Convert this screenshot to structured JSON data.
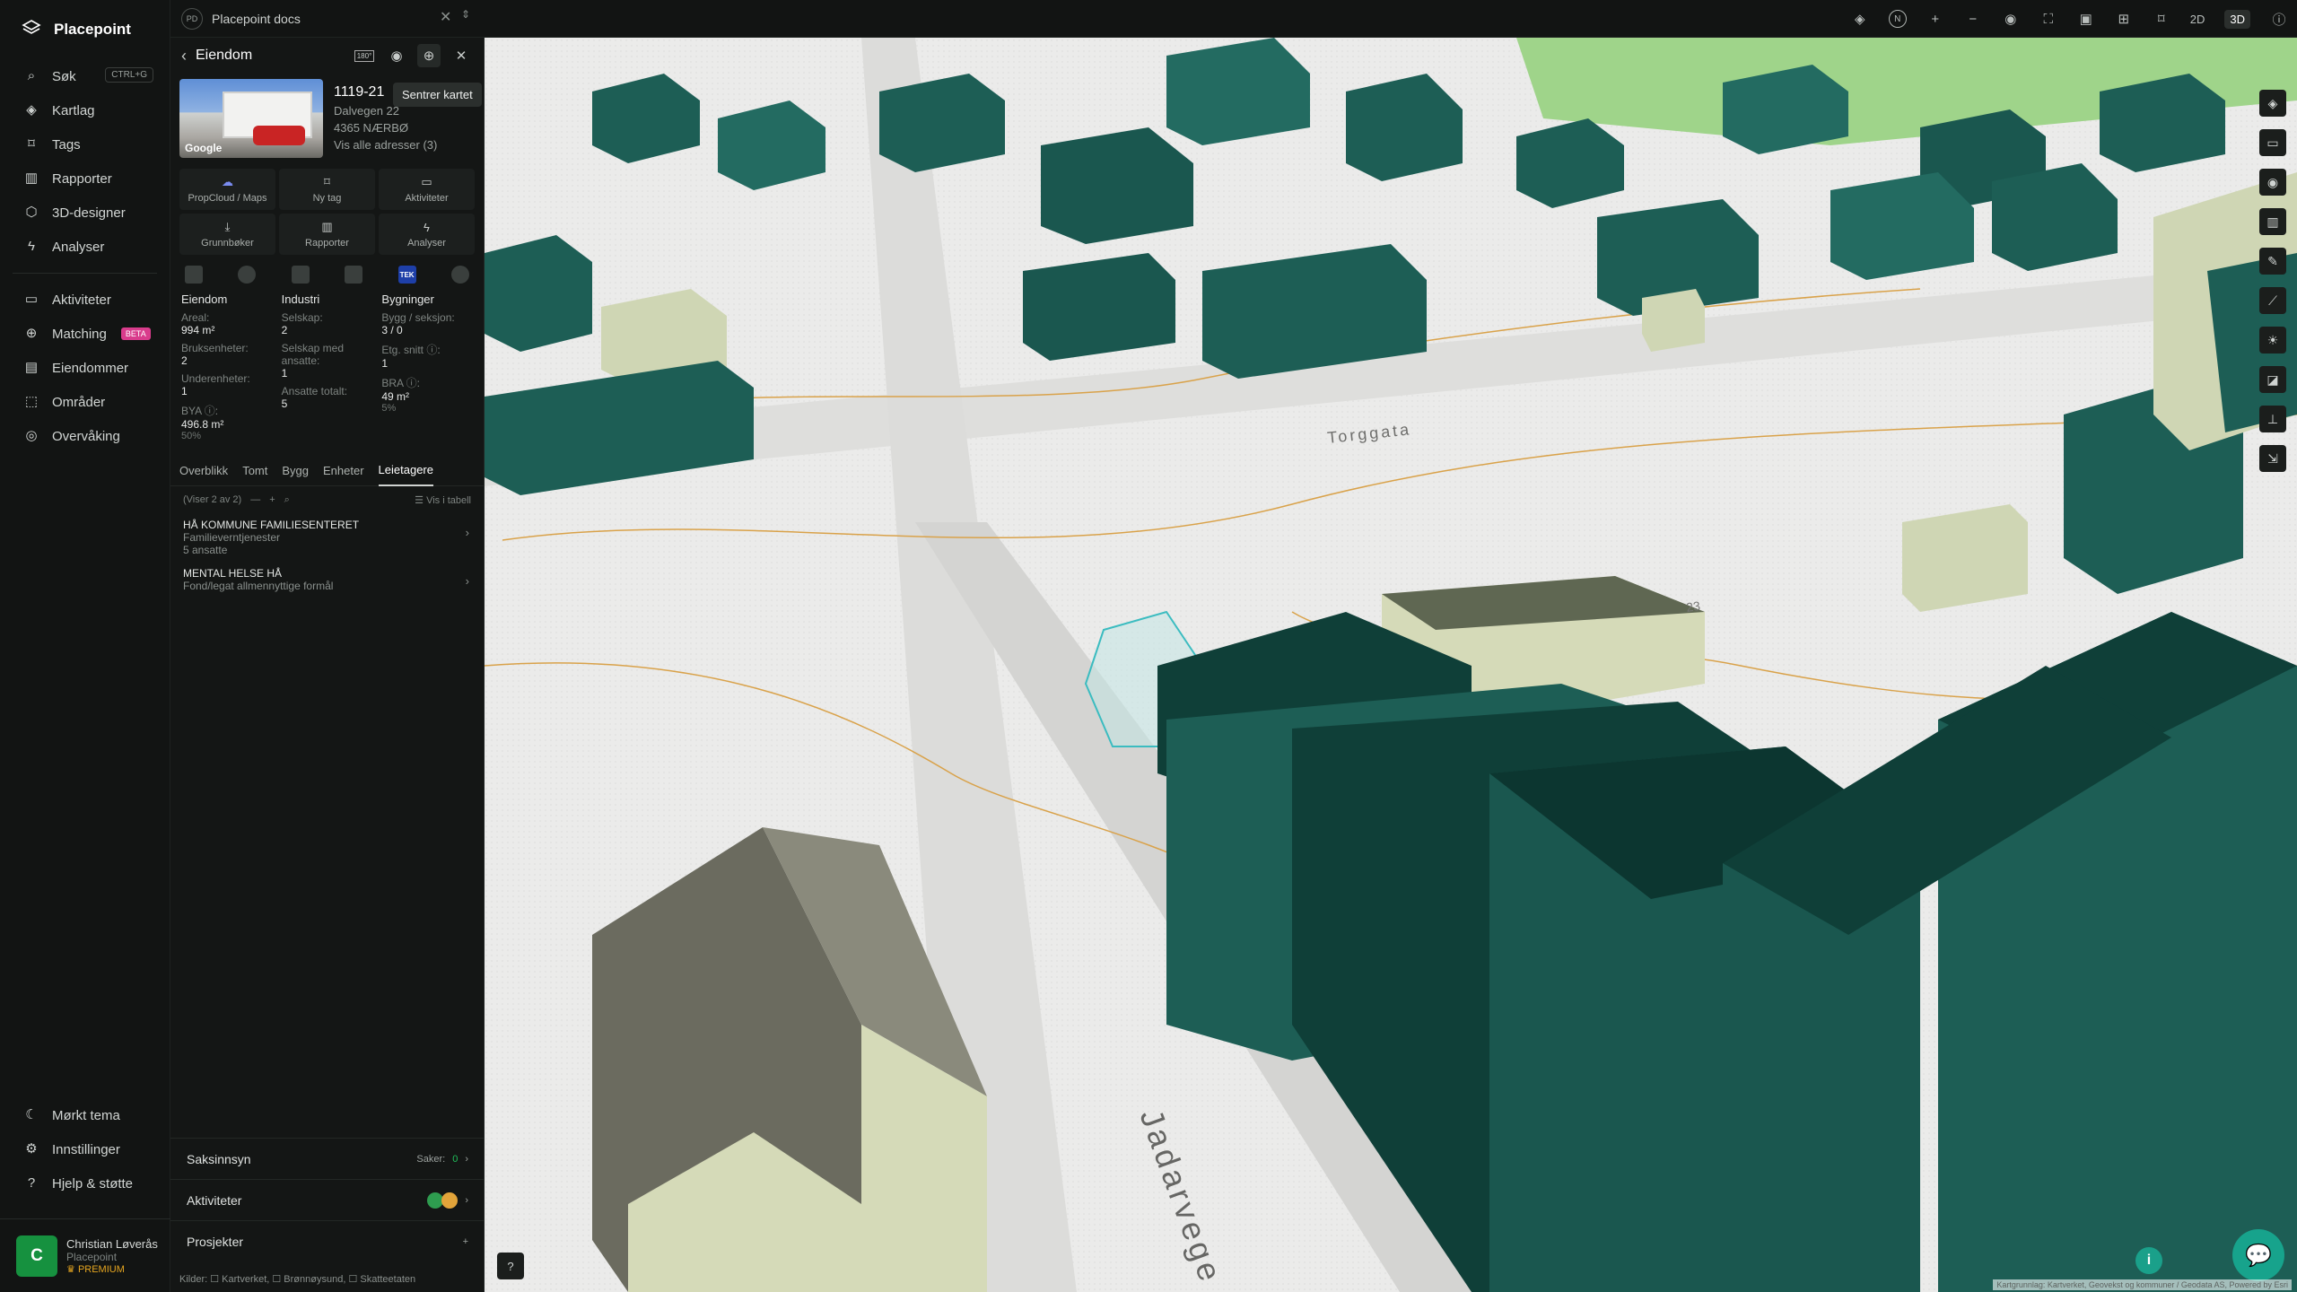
{
  "app": {
    "name": "Placepoint"
  },
  "nav": {
    "items": [
      {
        "label": "Søk",
        "kbd": "CTRL+G"
      },
      {
        "label": "Kartlag"
      },
      {
        "label": "Tags"
      },
      {
        "label": "Rapporter"
      },
      {
        "label": "3D-designer"
      },
      {
        "label": "Analyser"
      }
    ],
    "items2": [
      {
        "label": "Aktiviteter"
      },
      {
        "label": "Matching",
        "badge": "BETA"
      },
      {
        "label": "Eiendommer"
      },
      {
        "label": "Områder"
      },
      {
        "label": "Overvåking"
      }
    ],
    "bottom": [
      {
        "label": "Mørkt tema"
      },
      {
        "label": "Innstillinger"
      },
      {
        "label": "Hjelp & støtte"
      }
    ],
    "user": {
      "initial": "C",
      "name": "Christian Løverås",
      "org": "Placepoint",
      "plan": "PREMIUM"
    }
  },
  "topbar": {
    "doc_initials": "PD",
    "doc_title": "Placepoint docs",
    "north": "N",
    "mode_2d": "2D",
    "mode_3d": "3D"
  },
  "panel": {
    "title": "Eiendom",
    "tooltip": "Sentrer kartet",
    "badge": "180°",
    "photo_label": "Google",
    "gnr": "1119-21",
    "address": "Dalvegen 22",
    "postal": "4365 NÆRBØ",
    "all_addresses": "Vis alle adresser (3)",
    "actions": [
      {
        "label": "PropCloud / Maps"
      },
      {
        "label": "Ny tag"
      },
      {
        "label": "Aktiviteter"
      },
      {
        "label": "Grunnbøker"
      },
      {
        "label": "Rapporter"
      },
      {
        "label": "Analyser"
      }
    ],
    "tek_label": "TEK",
    "stats": {
      "col1_head": "Eiendom",
      "col2_head": "Industri",
      "col3_head": "Bygninger",
      "areal_k": "Areal:",
      "areal_v": "994 m²",
      "bruks_k": "Bruksenheter:",
      "bruks_v": "2",
      "under_k": "Underenheter:",
      "under_v": "1",
      "bya_k": "BYA ⓘ:",
      "bya_v": "496.8 m²",
      "bya_s": "50%",
      "selskap_k": "Selskap:",
      "selskap_v": "2",
      "ansatte_k": "Selskap med ansatte:",
      "ansatte_v": "1",
      "anstot_k": "Ansatte totalt:",
      "anstot_v": "5",
      "bygg_k": "Bygg / seksjon:",
      "bygg_v": "3 / 0",
      "etg_k": "Etg. snitt ⓘ:",
      "etg_v": "1",
      "bra_k": "BRA ⓘ:",
      "bra_v": "49 m²",
      "bra_s": "5%"
    },
    "tabs": [
      "Overblikk",
      "Tomt",
      "Bygg",
      "Enheter",
      "Leietagere"
    ],
    "list_count": "(Viser 2 av 2)",
    "list_table": "Vis i tabell",
    "orgs": [
      {
        "name": "HÅ KOMMUNE FAMILIESENTERET",
        "desc": "Familieverntjenester",
        "emp": "5 ansatte"
      },
      {
        "name": "MENTAL HELSE HÅ",
        "desc": "Fond/legat allmennyttige formål"
      }
    ],
    "saksinnsyn": "Saksinnsyn",
    "saker_label": "Saker:",
    "saker_count": "0",
    "aktiviteter": "Aktiviteter",
    "prosjekter": "Prosjekter",
    "sources": "Kilder: ☐ Kartverket, ☐ Brønnøysund, ☐ Skatteetaten"
  },
  "map": {
    "street1": "Torggata",
    "street2": "Jadarvege",
    "addr_no": "23",
    "attribution": "Kartgrunnlag: Kartverket, Geovekst og kommuner / Geodata AS, Powered by Esri",
    "colors": {
      "building": "#1d5e55",
      "building_dark": "#0f3f38",
      "roof": "#236b61",
      "ground": "#e9e9e7",
      "contour": "#d9a24a"
    }
  }
}
